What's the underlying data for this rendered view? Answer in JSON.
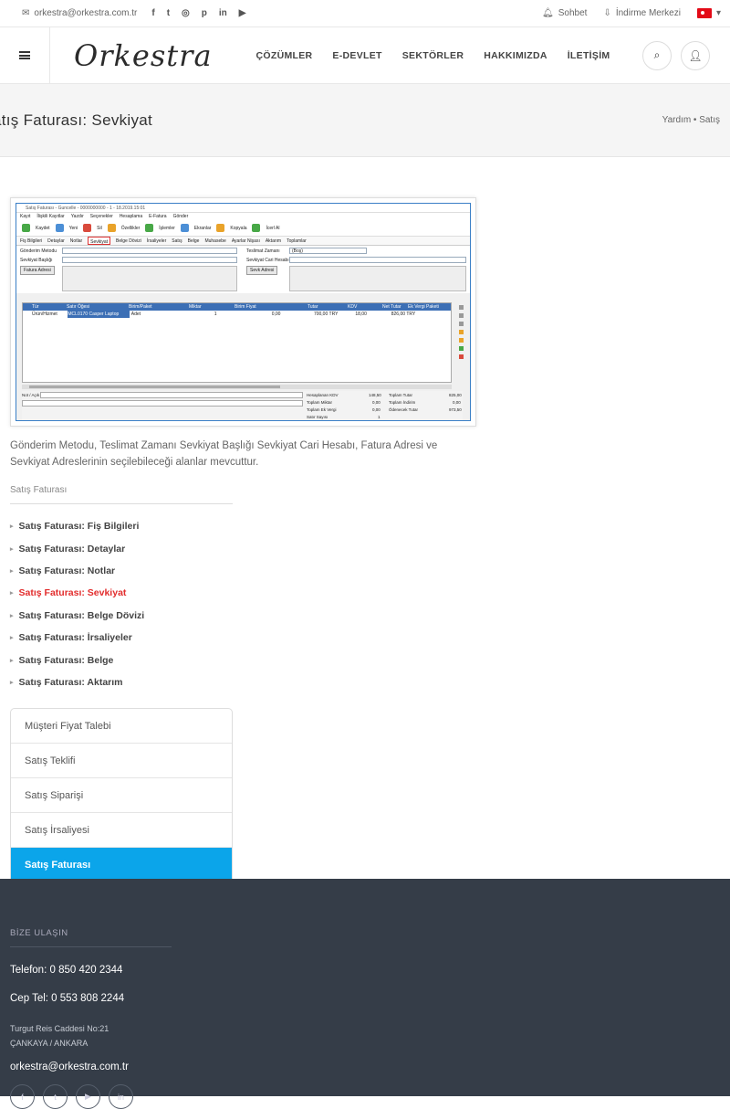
{
  "topbar": {
    "email": "orkestra@orkestra.com.tr",
    "socials": [
      "f",
      "t",
      "◎",
      "p",
      "in",
      "▶"
    ],
    "chat": "Sohbet",
    "download": "İndirme Merkezi",
    "lang_arrow": "▾"
  },
  "header": {
    "logo": "Orkestra",
    "nav": [
      "ÇÖZÜMLER",
      "E-DEVLET",
      "SEKTÖRLER",
      "HAKKIMIZDA",
      "İLETİŞİM"
    ]
  },
  "page": {
    "title": "atış Faturası: Sevkiyat",
    "breadcrumb": "Yardım • Satış"
  },
  "screenshot": {
    "window_title": "Satış Faturası - Guncelle - 0000000000 - 1 - 18.2019.15:01",
    "menu": [
      "Kayıt",
      "İlişkili Kayıtlar",
      "Yazdır",
      "Seçenekler",
      "Hesaplama",
      "E-Fatura",
      "Gönder"
    ],
    "toolbar": [
      "Kaydet",
      "Yeni",
      "Sil",
      "Özellikler",
      "İşlemler",
      "Ekranlar",
      "Kopyala",
      "İcerl Al"
    ],
    "tabs": [
      "Fiş Bilgileri",
      "Detaylar",
      "Notlar",
      "Sevkiyat",
      "Belge Dövizi",
      "İrsaliyeler",
      "Satış",
      "Belge",
      "Muhasebe",
      "Ayarlar Nişası",
      "Aktarım",
      "Toplamlar"
    ],
    "active_tab": "Sevkiyat",
    "form": {
      "shipping_method": "Gönderim Metodu",
      "delivery_time": "Teslimat Zamanı",
      "delivery_value": "(Boş)",
      "shipping_title": "Sevkiyat Başlığı",
      "shipping_account": "Sevkiyat Cari Hesabı",
      "invoice_address_btn": "Fatura Adresi",
      "shipping_address_btn": "Sevk Adresi"
    },
    "grid_headers": [
      "Tür",
      "Satır Öğesi",
      "Birim/Paket",
      "Miktar",
      "Birim Fiyat",
      "Tutar",
      "KDV",
      "Net Tutar",
      "Ek Vergi Paketi"
    ],
    "grid_row": [
      "Ürün/Hizmet",
      "MCL0170 Casper Laptop",
      "Adet",
      "1",
      "0,00",
      "700,00 TRY",
      "18,00",
      "826,00 TRY"
    ],
    "totals": {
      "l1": "Hesaplanan KDV",
      "v1": "148,50",
      "r1": "Toplam Tutar",
      "rv1": "825,00",
      "l2": "Toplam Miktar",
      "v2": "0,00",
      "r2": "Toplam İndirim",
      "rv2": "0,00",
      "l3": "Toplam Ek Vergi",
      "v3": "0,00",
      "r3": "Ödenecek Tutar",
      "rv3": "973,50",
      "l4": "Satır Sayısı",
      "v4": "1"
    },
    "note_label": "Not / Açık"
  },
  "description": "Gönderim Metodu, Teslimat Zamanı Sevkiyat Başlığı Sevkiyat Cari Hesabı, Fatura Adresi ve Sevkiyat Adreslerinin seçilebileceği alanlar mevcuttur.",
  "related": {
    "title": "Satış Faturası",
    "links": [
      {
        "label": "Satış Faturası: Fiş Bilgileri",
        "active": false
      },
      {
        "label": "Satış Faturası: Detaylar",
        "active": false
      },
      {
        "label": "Satış Faturası: Notlar",
        "active": false
      },
      {
        "label": "Satış Faturası: Sevkiyat",
        "active": true
      },
      {
        "label": "Satış Faturası: Belge Dövizi",
        "active": false
      },
      {
        "label": "Satış Faturası: İrsaliyeler",
        "active": false
      },
      {
        "label": "Satış Faturası: Belge",
        "active": false
      },
      {
        "label": "Satış Faturası: Aktarım",
        "active": false
      }
    ]
  },
  "side_menu": [
    {
      "label": "Müşteri Fiyat Talebi",
      "active": false
    },
    {
      "label": "Satış Teklifi",
      "active": false
    },
    {
      "label": "Satış Siparişi",
      "active": false
    },
    {
      "label": "Satış İrsaliyesi",
      "active": false
    },
    {
      "label": "Satış Faturası",
      "active": true
    }
  ],
  "footer": {
    "title": "BİZE ULAŞIN",
    "phone": "Telefon: 0 850 420 2344",
    "mobile": "Cep Tel: 0 553 808 2244",
    "address_line1": "Turgut Reis Caddesi No:21",
    "address_line2": "ÇANKAYA / ANKARA",
    "email": "orkestra@orkestra.com.tr",
    "socials": [
      "f",
      "t",
      "▶",
      "in"
    ]
  },
  "colors": {
    "accent": "#0ba5ea",
    "active_link": "#e22d2d",
    "footer_bg": "#353d48"
  }
}
